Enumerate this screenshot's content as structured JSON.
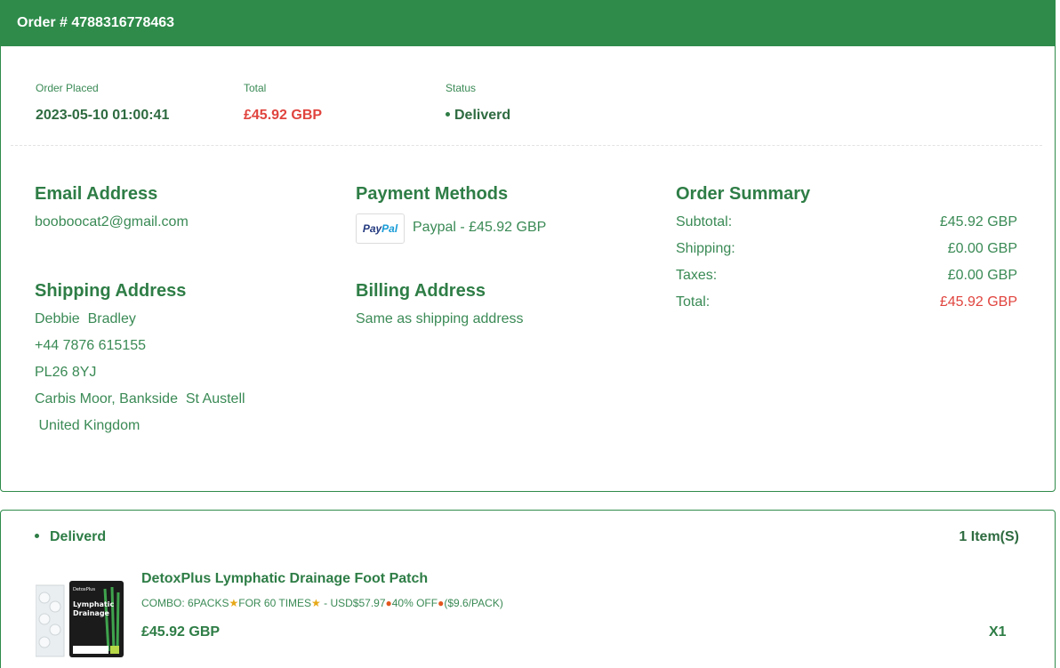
{
  "header": {
    "order_number": "Order # 4788316778463"
  },
  "meta": {
    "placed_label": "Order Placed",
    "placed_value": "2023-05-10 01:00:41",
    "total_label": "Total",
    "total_value": "£45.92 GBP",
    "status_label": "Status",
    "status_value": "Deliverd"
  },
  "email": {
    "title": "Email Address",
    "value": "booboocat2@gmail.com"
  },
  "payment": {
    "title": "Payment Methods",
    "logo_a": "Pay",
    "logo_b": "Pal",
    "value": "Paypal - £45.92 GBP"
  },
  "shipping": {
    "title": "Shipping Address",
    "lines": [
      "Debbie  Bradley",
      "+44 7876 615155",
      "PL26 8YJ",
      "Carbis Moor, Bankside  St Austell",
      " United Kingdom"
    ]
  },
  "billing": {
    "title": "Billing Address",
    "value": "Same as shipping address"
  },
  "summary": {
    "title": "Order Summary",
    "rows": [
      {
        "label": "Subtotal:",
        "value": "£45.92 GBP"
      },
      {
        "label": "Shipping:",
        "value": "£0.00 GBP"
      },
      {
        "label": "Taxes:",
        "value": "£0.00 GBP"
      },
      {
        "label": "Total:",
        "value": "£45.92 GBP"
      }
    ]
  },
  "items": {
    "status": "Deliverd",
    "count": "1 Item(S)",
    "product": {
      "name": "DetoxPlus Lymphatic Drainage Foot Patch",
      "variant_a": "COMBO: 6PACKS",
      "variant_b": "FOR 60 TIMES",
      "variant_c": " - USD$57.97",
      "variant_d": "40% OFF",
      "variant_e": "($9.6/PACK)",
      "price": "£45.92 GBP",
      "quantity": "X1",
      "image_brand": "DetoxPlus",
      "image_line1": "Lymphatic",
      "image_line2": "Drainage"
    }
  },
  "colors": {
    "brand_green": "#2e8b4a",
    "text_green": "#2e7d46",
    "price_red": "#e0443e"
  }
}
